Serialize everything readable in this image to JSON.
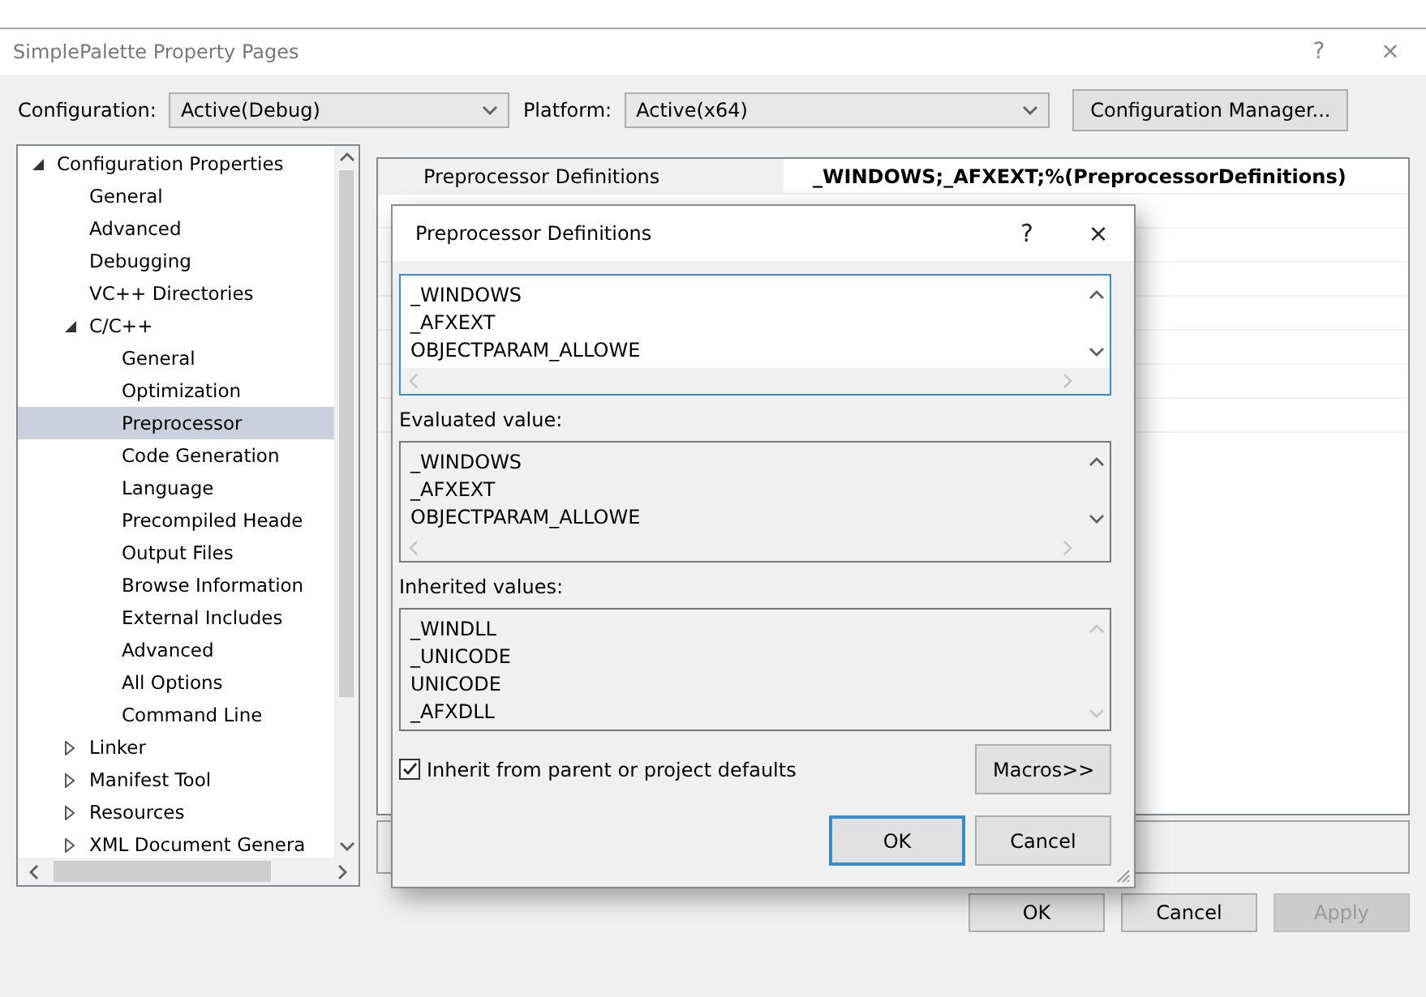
{
  "window": {
    "title": "SimplePalette Property Pages",
    "help": "?",
    "close": "×"
  },
  "config_bar": {
    "configuration_label": "Configuration:",
    "configuration_value": "Active(Debug)",
    "platform_label": "Platform:",
    "platform_value": "Active(x64)",
    "manager_button": "Configuration Manager..."
  },
  "tree": [
    {
      "label": "Configuration Properties",
      "expanded": true,
      "selected": false,
      "children": [
        {
          "label": "General",
          "selected": false
        },
        {
          "label": "Advanced",
          "selected": false
        },
        {
          "label": "Debugging",
          "selected": false
        },
        {
          "label": "VC++ Directories",
          "selected": false
        },
        {
          "label": "C/C++",
          "expanded": true,
          "selected": false,
          "children": [
            {
              "label": "General",
              "selected": false
            },
            {
              "label": "Optimization",
              "selected": false
            },
            {
              "label": "Preprocessor",
              "selected": true
            },
            {
              "label": "Code Generation",
              "selected": false
            },
            {
              "label": "Language",
              "selected": false
            },
            {
              "label": "Precompiled Heade",
              "selected": false
            },
            {
              "label": "Output Files",
              "selected": false
            },
            {
              "label": "Browse Information",
              "selected": false
            },
            {
              "label": "External Includes",
              "selected": false
            },
            {
              "label": "Advanced",
              "selected": false
            },
            {
              "label": "All Options",
              "selected": false
            },
            {
              "label": "Command Line",
              "selected": false
            }
          ]
        },
        {
          "label": "Linker",
          "expanded": false,
          "selected": false
        },
        {
          "label": "Manifest Tool",
          "expanded": false,
          "selected": false
        },
        {
          "label": "Resources",
          "expanded": false,
          "selected": false
        },
        {
          "label": "XML Document Genera",
          "expanded": false,
          "selected": false
        }
      ]
    }
  ],
  "property_grid": {
    "rows": [
      {
        "name": "Preprocessor Definitions",
        "value": "_WINDOWS;_AFXEXT;%(PreprocessorDefinitions)"
      }
    ]
  },
  "dialog": {
    "title": "Preprocessor Definitions",
    "help": "?",
    "close": "×",
    "edit_lines": [
      "_WINDOWS",
      "_AFXEXT",
      "OBJECTPARAM_ALLOWE"
    ],
    "evaluated_label": "Evaluated value:",
    "evaluated_lines": [
      "_WINDOWS",
      "_AFXEXT",
      "OBJECTPARAM_ALLOWE"
    ],
    "inherited_label": "Inherited values:",
    "inherited_lines": [
      "_WINDLL",
      "_UNICODE",
      "UNICODE",
      "_AFXDLL"
    ],
    "inherit_checkbox": {
      "label": "Inherit from parent or project defaults",
      "checked": true
    },
    "macros_button": "Macros>>",
    "ok_button": "OK",
    "cancel_button": "Cancel"
  },
  "buttons": [
    {
      "label": "OK",
      "disabled": false
    },
    {
      "label": "Cancel",
      "disabled": false
    },
    {
      "label": "Apply",
      "disabled": true
    }
  ]
}
